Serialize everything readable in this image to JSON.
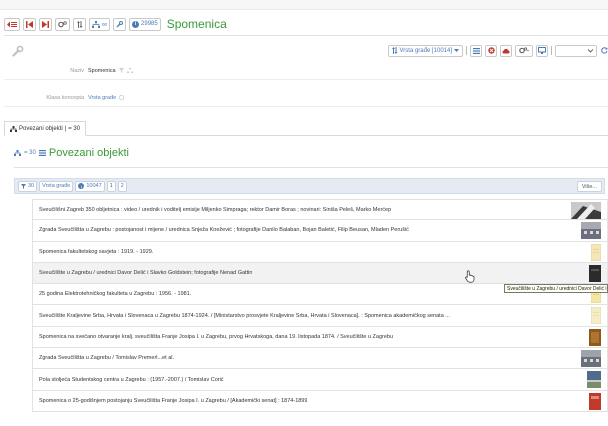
{
  "header": {
    "count": "29985",
    "title": "Spomenica",
    "glyph_label": "00"
  },
  "toolbar2": {
    "vrsta_label": "Vrsta građe [10014]"
  },
  "properties": [
    {
      "label": "Naziv",
      "value": "Spomenica",
      "link": false
    },
    {
      "label": "Klasa koncepta",
      "value": "Vrsta građe",
      "link": true
    }
  ],
  "tab": {
    "label": "Povezani objekti",
    "count": "= 30"
  },
  "section": {
    "count": "= 30",
    "title": "Povezani objekti"
  },
  "filterbar": {
    "filter_count": "30",
    "vrsta": "Vrsta građe",
    "count": "10047",
    "page1": "1",
    "page2": "2",
    "more": "Više..."
  },
  "items": [
    {
      "text": "Sveučilišni Zagreb 350 obljetnica : video / urednik i voditelj emisije Miljenko Šimpraga; rektor Damir Boras ; novinari: Siniša Peleš, Marko Merćep",
      "thumb_color": "#3b3b3b",
      "thumb_color2": "#c9c9c9",
      "thumb_kind": "photo-dark"
    },
    {
      "text": "Zgrada Sveučilišta u Zagrebu : postojanost i mijene / urednica Snježa Knežević ; fotografije Danilo Balaban, Bojan Baletić, Filip Beusan, Mladen Perušić",
      "thumb_color": "#6b6f80",
      "thumb_color2": "#a9a9b2",
      "thumb_kind": "building"
    },
    {
      "text": "Spomenica fakultetskog savjeta : 1919. - 1929.",
      "thumb_color": "#f3e6b8",
      "thumb_color2": "#e8d79a",
      "thumb_kind": "paper"
    },
    {
      "text": "Sveučilište u Zagrebu / urednici Davor Delić i Slavko Goldstein; fotografije Nenad Gattin",
      "thumb_color": "#2b2b2b",
      "thumb_color2": "#555555",
      "thumb_kind": "dark"
    },
    {
      "text": "25 godina Elektrotehničkog fakulteta u Zagrebu : 1956. - 1981.",
      "thumb_color": "#f4e7a5",
      "thumb_color2": "#e6d279",
      "thumb_kind": "paper"
    },
    {
      "text": "Sveučilište Kraljevine Srba, Hrvata i Slovenaca u Zagrebu 1874-1924. / [Ministarstvo prosvjete Kraljevine Srba, Hrvata i Slovenaca]. : Spomenica akademičkog senata ...",
      "thumb_color": "#f3eec9",
      "thumb_color2": "#e8e0a8",
      "thumb_kind": "paper"
    },
    {
      "text": "Spomenica na svečano otvaranje kralj. sveučilišta Franje Josipa I. u Zagrebu, prvog Hrvatskoga, dana 19. listopada 1874. / Sveučilište u Zagrebu",
      "thumb_color": "#8c5a1e",
      "thumb_color2": "#b07430",
      "thumb_kind": "brown"
    },
    {
      "text": "Zgrada Sveučilišta u Zagrebu / Tomislav Premerl...et al.",
      "thumb_color": "#6a6f7a",
      "thumb_color2": "#9da2ab",
      "thumb_kind": "building"
    },
    {
      "text": "Pola stoljeća Studentskog centra u Zagrebu : (1957.-2007.) / Tomislav Čorić",
      "thumb_color": "#4f6d8a",
      "thumb_color2": "#c8c8c8",
      "thumb_kind": "photo-blue"
    },
    {
      "text": "Spomenica o 25-godišnjem postojanju Sveučilišta Franje Josipa I. u Zagrebu / [Akademički senat] : 1874-1899",
      "thumb_color": "#c0392b",
      "thumb_color2": "#e08a7a",
      "thumb_kind": "red"
    }
  ],
  "tooltip": "Sveučilište u Zagrebu / urednici Davor Delić i Slavko Goldstein; fotografije Nenad Gattin",
  "colors": {
    "accent_blue": "#4a7ab7",
    "title_green": "#3a9a3a",
    "filterbar_bg": "#e4ebf3"
  }
}
